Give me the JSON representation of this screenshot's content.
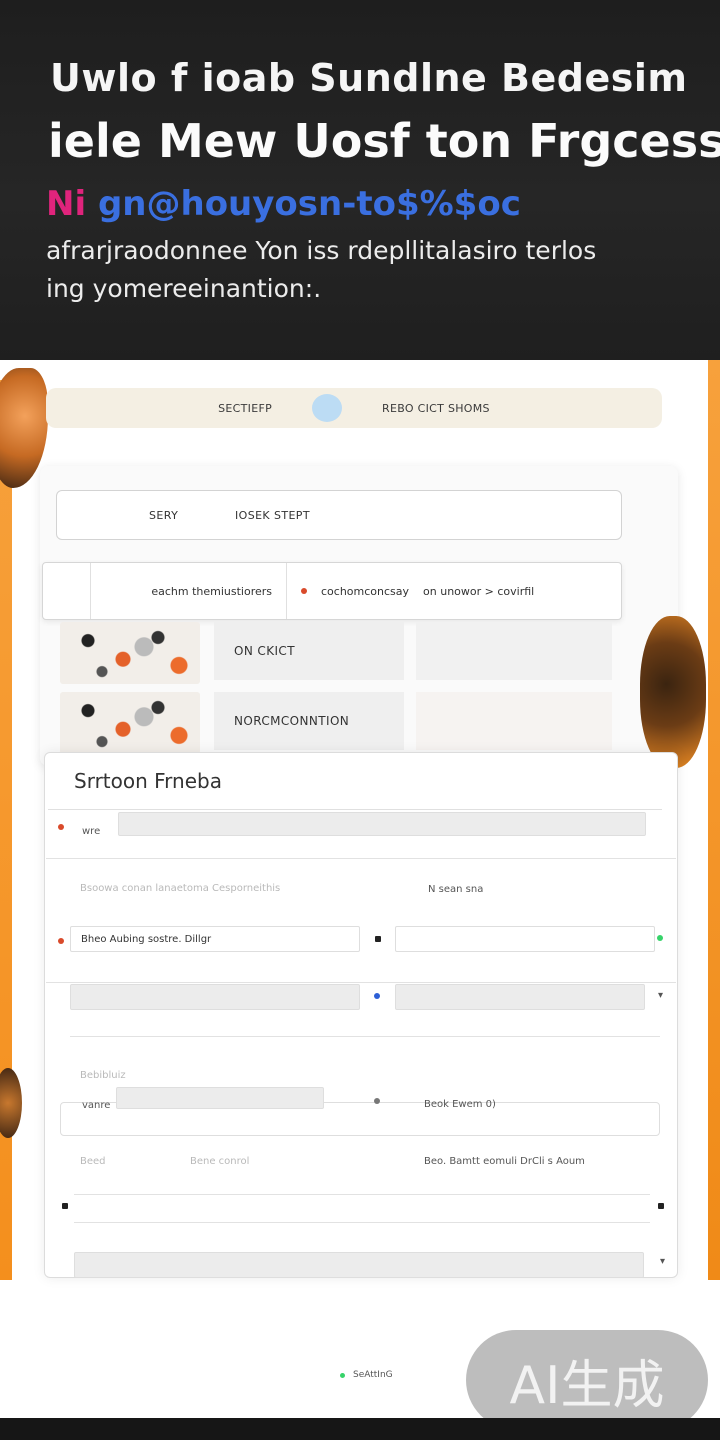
{
  "hero": {
    "title_line1": "Uwlo f ioab Sundlne Bedesim",
    "title_line2": "iele Mew Uosf ton Frgcess",
    "glitch_part1": "Ni",
    "glitch_part2": "gn@houyosn-to$%$oc",
    "subtitle_line1": "afrarjraodonnee Yon iss rdepllitalasiro terlos",
    "subtitle_line2": "ing yomereeinantion:."
  },
  "banner": {
    "left_text": "SECTIEFP",
    "right_text": "REBO CICT SHOMS"
  },
  "search": {
    "label1": "SERY",
    "label2": "IOSEK STEPT"
  },
  "filters": {
    "left_text": "eachm themiustiorers",
    "right_text": "cochomconcsay",
    "right_text2": "on unowor > covirfil"
  },
  "tiles": {
    "tile1": "ON CKICT",
    "tile2": "NORCMCONNTION"
  },
  "form": {
    "title": "Srrtoon Frneba",
    "row1_label": "wre",
    "section_left": "Bsoowa conan lanaetoma Cesporneithis",
    "section_right": "N sean sna",
    "row2_field": "Bheo Aubing sostre. Dillgr",
    "sublabel": "Bebibluiz",
    "row3_label": "vanre",
    "row3_right": "Beok Ewem 0)",
    "faint_left": "Beed",
    "faint_mid": "Bene conrol",
    "row4_right": "Beo. Bamtt eomuli DrCli s Aoum",
    "footer_link": "SeAttInG"
  },
  "watermark": "AI生成",
  "colors": {
    "accent_orange": "#f48f1d",
    "accent_red": "#d94a2b",
    "accent_green": "#37d36a",
    "accent_blue": "#2d5fd6"
  },
  "icons": [
    "dot-red-icon",
    "dot-green-icon",
    "dot-blue-icon",
    "square-icon",
    "chevron-down-icon"
  ]
}
